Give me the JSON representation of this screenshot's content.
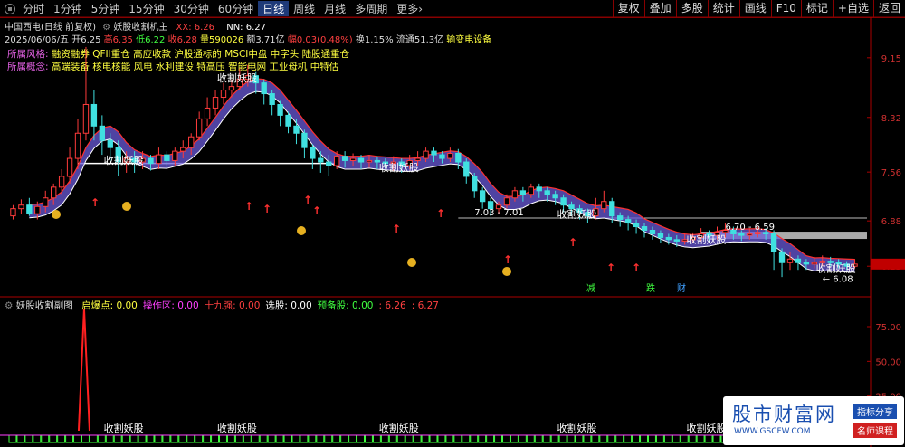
{
  "toolbar": {
    "periods": [
      "分时",
      "1分钟",
      "5分钟",
      "15分钟",
      "30分钟",
      "60分钟",
      "日线",
      "周线",
      "月线",
      "多周期",
      "更多"
    ],
    "active": "日线",
    "more_arrow": "›",
    "right_buttons": [
      "复权",
      "叠加",
      "多股",
      "统计",
      "画线",
      "F10",
      "标记",
      "+自选",
      "返回"
    ]
  },
  "header": {
    "stock_title": "中国西电(日线 前复权)",
    "formula": "妖股收割机主",
    "xx_label": "XX: 6.26",
    "nn_label": "NN: 6.27"
  },
  "quote": {
    "date": "2025/06/06/五",
    "open_label": "开",
    "open": "6.25",
    "high_label": "高",
    "high": "6.35",
    "low_label": "低",
    "low": "6.22",
    "close_label": "收",
    "close": "6.28",
    "volume_label": "量",
    "volume": "590026",
    "amount_label": "额",
    "amount": "3.71亿",
    "change_label": "幅",
    "change": "0.03(0.48%)",
    "turnover": "换1.15%",
    "float_cap": "流通51.3亿",
    "industry": "输变电设备"
  },
  "sectors": {
    "style_label": "所属风格:",
    "style_value": "融资融券 QFII重仓 高应收款 沪股通标的 MSCI中盘 中字头 陆股通重仓",
    "concept_label": "所属概念:",
    "concept_value": "高端装备 核电核能 风电 水利建设 特高压 智能电网 工业母机 中特估"
  },
  "indicator": {
    "title": "妖股收割副图",
    "fields": [
      {
        "label": "启爆点: 0.00",
        "color": "#ffff40"
      },
      {
        "label": "操作区: 0.00",
        "color": "#ff40ff"
      },
      {
        "label": "十九强: 0.00",
        "color": "#ff4040"
      },
      {
        "label": "选股: 0.00",
        "color": "#ffffff"
      },
      {
        "label": "预备股: 0.00",
        "color": "#40ff40"
      },
      {
        "label": ": 6.26",
        "color": "#ff4040"
      },
      {
        "label": ": 6.27",
        "color": "#ff4040"
      }
    ]
  },
  "chart_data": {
    "type": "candlestick",
    "symbol": "中国西电",
    "period": "日线",
    "ylim": [
      5.85,
      9.45
    ],
    "y_ticks": [
      6.25,
      6.88,
      7.56,
      8.32,
      9.15
    ],
    "candles": [
      [
        6.95,
        7.05,
        6.9,
        7.1
      ],
      [
        7.05,
        7.1,
        6.98,
        7.18
      ],
      [
        7.1,
        6.98,
        6.95,
        7.2
      ],
      [
        6.98,
        7.08,
        6.9,
        7.15
      ],
      [
        7.08,
        7.2,
        7.0,
        7.3
      ],
      [
        7.2,
        7.35,
        7.1,
        7.4
      ],
      [
        7.35,
        7.5,
        7.25,
        7.6
      ],
      [
        7.5,
        7.75,
        7.4,
        7.9
      ],
      [
        7.75,
        8.1,
        7.6,
        8.3
      ],
      [
        8.1,
        8.5,
        8.0,
        9.3
      ],
      [
        8.5,
        8.2,
        8.0,
        8.7
      ],
      [
        8.2,
        8.0,
        7.8,
        8.35
      ],
      [
        8.0,
        7.9,
        7.7,
        8.1
      ],
      [
        7.9,
        7.7,
        7.5,
        8.0
      ],
      [
        7.7,
        7.75,
        7.55,
        7.85
      ],
      [
        7.75,
        7.7,
        7.55,
        7.85
      ],
      [
        7.7,
        7.75,
        7.6,
        7.85
      ],
      [
        7.75,
        7.68,
        7.58,
        7.8
      ],
      [
        7.68,
        7.8,
        7.6,
        7.9
      ],
      [
        7.8,
        7.72,
        7.62,
        7.85
      ],
      [
        7.72,
        7.85,
        7.65,
        7.9
      ],
      [
        7.85,
        7.9,
        7.75,
        8.0
      ],
      [
        7.9,
        8.05,
        7.8,
        8.1
      ],
      [
        8.05,
        8.3,
        8.0,
        8.4
      ],
      [
        8.3,
        8.45,
        8.2,
        8.6
      ],
      [
        8.45,
        8.6,
        8.35,
        8.7
      ],
      [
        8.6,
        8.7,
        8.5,
        8.8
      ],
      [
        8.7,
        8.75,
        8.6,
        8.85
      ],
      [
        8.75,
        8.85,
        8.7,
        9.0
      ],
      [
        8.85,
        8.9,
        8.75,
        9.05
      ],
      [
        8.9,
        8.8,
        8.65,
        8.95
      ],
      [
        8.8,
        8.65,
        8.5,
        8.85
      ],
      [
        8.65,
        8.5,
        8.35,
        8.7
      ],
      [
        8.5,
        8.35,
        8.2,
        8.55
      ],
      [
        8.35,
        8.2,
        8.1,
        8.4
      ],
      [
        8.2,
        8.1,
        7.95,
        8.3
      ],
      [
        8.1,
        7.9,
        7.75,
        8.15
      ],
      [
        7.9,
        7.75,
        7.6,
        7.95
      ],
      [
        7.75,
        7.7,
        7.55,
        7.85
      ],
      [
        7.7,
        7.65,
        7.5,
        7.8
      ],
      [
        7.65,
        7.78,
        7.6,
        7.85
      ],
      [
        7.78,
        7.72,
        7.62,
        7.85
      ],
      [
        7.72,
        7.75,
        7.65,
        7.82
      ],
      [
        7.75,
        7.7,
        7.6,
        7.8
      ],
      [
        7.7,
        7.72,
        7.62,
        7.8
      ],
      [
        7.72,
        7.7,
        7.6,
        7.78
      ],
      [
        7.7,
        7.68,
        7.6,
        7.75
      ],
      [
        7.68,
        7.7,
        7.58,
        7.78
      ],
      [
        7.7,
        7.65,
        7.55,
        7.75
      ],
      [
        7.65,
        7.72,
        7.6,
        7.8
      ],
      [
        7.72,
        7.75,
        7.65,
        7.85
      ],
      [
        7.75,
        7.85,
        7.7,
        7.9
      ],
      [
        7.85,
        7.8,
        7.7,
        7.9
      ],
      [
        7.8,
        7.75,
        7.68,
        7.85
      ],
      [
        7.75,
        7.82,
        7.7,
        7.9
      ],
      [
        7.82,
        7.7,
        7.6,
        7.88
      ],
      [
        7.7,
        7.5,
        7.4,
        7.75
      ],
      [
        7.5,
        7.3,
        7.2,
        7.55
      ],
      [
        7.3,
        7.15,
        7.05,
        7.35
      ],
      [
        7.15,
        7.05,
        6.95,
        7.2
      ],
      [
        7.05,
        7.1,
        6.98,
        7.15
      ],
      [
        7.1,
        7.2,
        7.05,
        7.25
      ],
      [
        7.2,
        7.3,
        7.15,
        7.35
      ],
      [
        7.3,
        7.25,
        7.15,
        7.35
      ],
      [
        7.25,
        7.35,
        7.2,
        7.4
      ],
      [
        7.35,
        7.3,
        7.2,
        7.4
      ],
      [
        7.3,
        7.25,
        7.15,
        7.35
      ],
      [
        7.25,
        7.2,
        7.1,
        7.3
      ],
      [
        7.2,
        7.1,
        7.0,
        7.25
      ],
      [
        7.1,
        7.05,
        6.95,
        7.15
      ],
      [
        7.05,
        7.0,
        6.9,
        7.1
      ],
      [
        7.0,
        6.95,
        6.85,
        7.05
      ],
      [
        6.95,
        7.05,
        6.9,
        7.2
      ],
      [
        7.05,
        7.15,
        7.0,
        7.3
      ],
      [
        7.15,
        6.95,
        6.85,
        7.2
      ],
      [
        6.95,
        6.9,
        6.8,
        7.0
      ],
      [
        6.9,
        6.85,
        6.75,
        6.95
      ],
      [
        6.85,
        6.8,
        6.7,
        6.9
      ],
      [
        6.8,
        6.75,
        6.65,
        6.85
      ],
      [
        6.75,
        6.7,
        6.62,
        6.8
      ],
      [
        6.7,
        6.65,
        6.58,
        6.75
      ],
      [
        6.65,
        6.62,
        6.55,
        6.7
      ],
      [
        6.62,
        6.6,
        6.52,
        6.68
      ],
      [
        6.6,
        6.62,
        6.55,
        6.7
      ],
      [
        6.62,
        6.65,
        6.58,
        6.72
      ],
      [
        6.65,
        6.7,
        6.6,
        6.78
      ],
      [
        6.7,
        6.68,
        6.6,
        6.75
      ],
      [
        6.68,
        6.72,
        6.62,
        6.8
      ],
      [
        6.72,
        6.75,
        6.65,
        6.85
      ],
      [
        6.75,
        6.7,
        6.62,
        6.8
      ],
      [
        6.7,
        6.68,
        6.6,
        6.75
      ],
      [
        6.68,
        6.7,
        6.62,
        6.78
      ],
      [
        6.7,
        6.72,
        6.65,
        6.8
      ],
      [
        6.72,
        6.7,
        6.62,
        6.78
      ],
      [
        6.7,
        6.45,
        6.2,
        6.75
      ],
      [
        6.45,
        6.3,
        6.1,
        6.5
      ],
      [
        6.3,
        6.35,
        6.2,
        6.45
      ],
      [
        6.35,
        6.3,
        6.2,
        6.4
      ],
      [
        6.3,
        6.28,
        6.2,
        6.35
      ],
      [
        6.28,
        6.3,
        6.22,
        6.38
      ],
      [
        6.3,
        6.32,
        6.25,
        6.4
      ],
      [
        6.32,
        6.3,
        6.25,
        6.38
      ],
      [
        6.3,
        6.28,
        6.22,
        6.35
      ],
      [
        6.28,
        6.25,
        6.2,
        6.32
      ],
      [
        6.25,
        6.28,
        6.22,
        6.35
      ]
    ],
    "overlay_labels": [
      "收割妖股",
      "收割妖股",
      "收割妖股",
      "收割妖股",
      "收割妖股",
      "收割妖股"
    ],
    "range_labels": [
      "7.03 - 7.01",
      "6.70 - 6.59",
      "← 6.08"
    ],
    "tags": [
      "减",
      "跌",
      "财"
    ],
    "sub_ylim": [
      0,
      90
    ],
    "sub_y_ticks": [
      75.0,
      50.0,
      25.0
    ],
    "sub_peak": 88
  },
  "watermark": {
    "title": "股市财富网",
    "url": "WWW.GSCFW.COM",
    "badge1": "指标分享",
    "badge2": "名师课程"
  }
}
